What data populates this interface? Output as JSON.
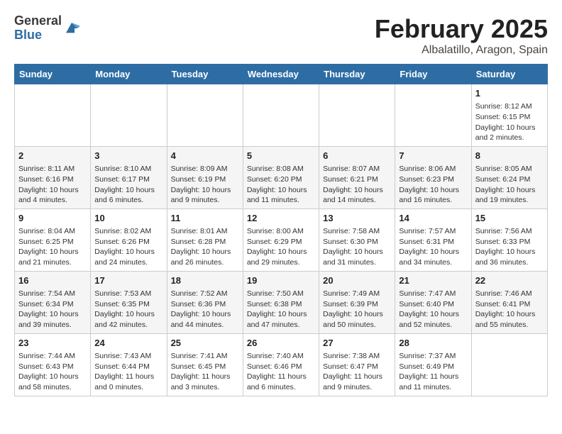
{
  "header": {
    "logo_general": "General",
    "logo_blue": "Blue",
    "title": "February 2025",
    "subtitle": "Albalatillo, Aragon, Spain"
  },
  "days_of_week": [
    "Sunday",
    "Monday",
    "Tuesday",
    "Wednesday",
    "Thursday",
    "Friday",
    "Saturday"
  ],
  "weeks": [
    [
      {
        "day": "",
        "text": ""
      },
      {
        "day": "",
        "text": ""
      },
      {
        "day": "",
        "text": ""
      },
      {
        "day": "",
        "text": ""
      },
      {
        "day": "",
        "text": ""
      },
      {
        "day": "",
        "text": ""
      },
      {
        "day": "1",
        "text": "Sunrise: 8:12 AM\nSunset: 6:15 PM\nDaylight: 10 hours and 2 minutes."
      }
    ],
    [
      {
        "day": "2",
        "text": "Sunrise: 8:11 AM\nSunset: 6:16 PM\nDaylight: 10 hours and 4 minutes."
      },
      {
        "day": "3",
        "text": "Sunrise: 8:10 AM\nSunset: 6:17 PM\nDaylight: 10 hours and 6 minutes."
      },
      {
        "day": "4",
        "text": "Sunrise: 8:09 AM\nSunset: 6:19 PM\nDaylight: 10 hours and 9 minutes."
      },
      {
        "day": "5",
        "text": "Sunrise: 8:08 AM\nSunset: 6:20 PM\nDaylight: 10 hours and 11 minutes."
      },
      {
        "day": "6",
        "text": "Sunrise: 8:07 AM\nSunset: 6:21 PM\nDaylight: 10 hours and 14 minutes."
      },
      {
        "day": "7",
        "text": "Sunrise: 8:06 AM\nSunset: 6:23 PM\nDaylight: 10 hours and 16 minutes."
      },
      {
        "day": "8",
        "text": "Sunrise: 8:05 AM\nSunset: 6:24 PM\nDaylight: 10 hours and 19 minutes."
      }
    ],
    [
      {
        "day": "9",
        "text": "Sunrise: 8:04 AM\nSunset: 6:25 PM\nDaylight: 10 hours and 21 minutes."
      },
      {
        "day": "10",
        "text": "Sunrise: 8:02 AM\nSunset: 6:26 PM\nDaylight: 10 hours and 24 minutes."
      },
      {
        "day": "11",
        "text": "Sunrise: 8:01 AM\nSunset: 6:28 PM\nDaylight: 10 hours and 26 minutes."
      },
      {
        "day": "12",
        "text": "Sunrise: 8:00 AM\nSunset: 6:29 PM\nDaylight: 10 hours and 29 minutes."
      },
      {
        "day": "13",
        "text": "Sunrise: 7:58 AM\nSunset: 6:30 PM\nDaylight: 10 hours and 31 minutes."
      },
      {
        "day": "14",
        "text": "Sunrise: 7:57 AM\nSunset: 6:31 PM\nDaylight: 10 hours and 34 minutes."
      },
      {
        "day": "15",
        "text": "Sunrise: 7:56 AM\nSunset: 6:33 PM\nDaylight: 10 hours and 36 minutes."
      }
    ],
    [
      {
        "day": "16",
        "text": "Sunrise: 7:54 AM\nSunset: 6:34 PM\nDaylight: 10 hours and 39 minutes."
      },
      {
        "day": "17",
        "text": "Sunrise: 7:53 AM\nSunset: 6:35 PM\nDaylight: 10 hours and 42 minutes."
      },
      {
        "day": "18",
        "text": "Sunrise: 7:52 AM\nSunset: 6:36 PM\nDaylight: 10 hours and 44 minutes."
      },
      {
        "day": "19",
        "text": "Sunrise: 7:50 AM\nSunset: 6:38 PM\nDaylight: 10 hours and 47 minutes."
      },
      {
        "day": "20",
        "text": "Sunrise: 7:49 AM\nSunset: 6:39 PM\nDaylight: 10 hours and 50 minutes."
      },
      {
        "day": "21",
        "text": "Sunrise: 7:47 AM\nSunset: 6:40 PM\nDaylight: 10 hours and 52 minutes."
      },
      {
        "day": "22",
        "text": "Sunrise: 7:46 AM\nSunset: 6:41 PM\nDaylight: 10 hours and 55 minutes."
      }
    ],
    [
      {
        "day": "23",
        "text": "Sunrise: 7:44 AM\nSunset: 6:43 PM\nDaylight: 10 hours and 58 minutes."
      },
      {
        "day": "24",
        "text": "Sunrise: 7:43 AM\nSunset: 6:44 PM\nDaylight: 11 hours and 0 minutes."
      },
      {
        "day": "25",
        "text": "Sunrise: 7:41 AM\nSunset: 6:45 PM\nDaylight: 11 hours and 3 minutes."
      },
      {
        "day": "26",
        "text": "Sunrise: 7:40 AM\nSunset: 6:46 PM\nDaylight: 11 hours and 6 minutes."
      },
      {
        "day": "27",
        "text": "Sunrise: 7:38 AM\nSunset: 6:47 PM\nDaylight: 11 hours and 9 minutes."
      },
      {
        "day": "28",
        "text": "Sunrise: 7:37 AM\nSunset: 6:49 PM\nDaylight: 11 hours and 11 minutes."
      },
      {
        "day": "",
        "text": ""
      }
    ]
  ]
}
